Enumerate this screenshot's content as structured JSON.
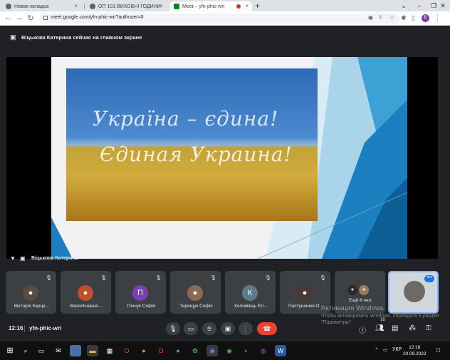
{
  "browser": {
    "tabs": [
      {
        "label": "Новая вкладка",
        "active": false
      },
      {
        "label": "ОП 101 ВИХОВНІ ГОДИНИ",
        "active": false
      },
      {
        "label": "Meet – yfn-phic-wri",
        "active": true
      }
    ],
    "url": "meet.google.com/yfn-phic-wri?authuser=0",
    "profile_initial": "Б"
  },
  "meet": {
    "presenting_banner": "Віцькова Катерина сейчас на главном экране",
    "slide": {
      "line1": "Україна – єдина!",
      "line2": "Єдиная Украина!"
    },
    "speaker_name": "Віцькова Катерина",
    "participants": [
      {
        "name": "Вікторія Карце...",
        "avatar_type": "photo",
        "color": "#5b4a3f"
      },
      {
        "name": "Василічшина ...",
        "avatar_type": "photo",
        "color": "#c0502a"
      },
      {
        "name": "Пінчук Софія",
        "avatar_type": "letter",
        "letter": "П",
        "color": "#7b3fb3"
      },
      {
        "name": "Терещук Софія",
        "avatar_type": "photo",
        "color": "#8a6a55"
      },
      {
        "name": "Коломієць Єл...",
        "avatar_type": "letter",
        "letter": "К",
        "color": "#5f7a8a"
      },
      {
        "name": "Пастушенко О...",
        "avatar_type": "photo",
        "color": "#4a3a33"
      },
      {
        "name": "Ещё 8 чел.",
        "avatar_type": "group",
        "color": "#3c4043"
      }
    ],
    "time": "12:16",
    "meeting_code": "yfn-phic-wri",
    "participant_count": "16",
    "activation": {
      "title": "Активация Windows",
      "subtitle": "Чтобы активировать Windows, перейдите в раздел \"Параметры\"."
    }
  },
  "taskbar": {
    "language": "УКР",
    "time": "12:16",
    "date": "20.09.2022"
  },
  "colors": {
    "meet_bg": "#202124",
    "tile_bg": "#3c4043",
    "end_call": "#ea4335",
    "accent": "#1a73e8"
  }
}
